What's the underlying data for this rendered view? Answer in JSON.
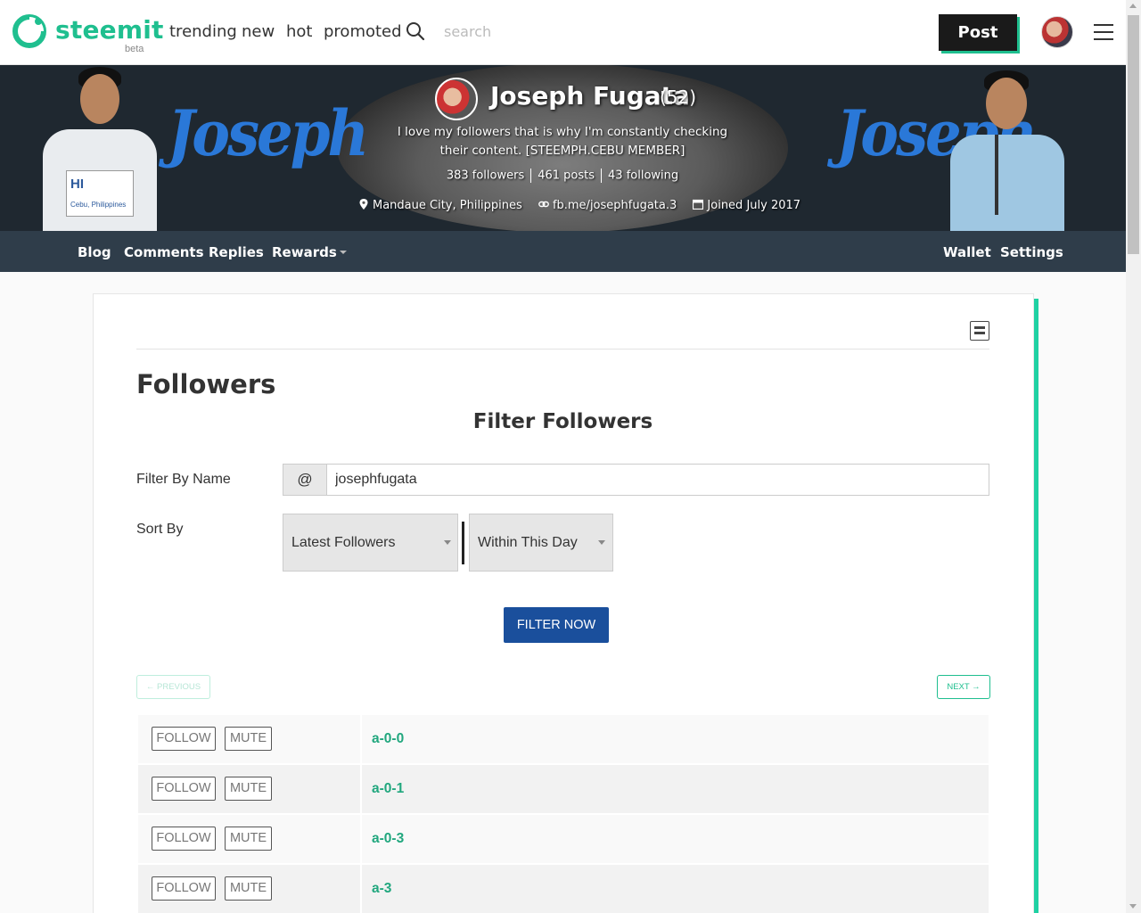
{
  "header": {
    "logo": "steemit",
    "beta": "beta",
    "nav": [
      "trending",
      "new",
      "hot",
      "promoted"
    ],
    "search_placeholder": "search",
    "post_label": "Post",
    "accent": "#1fbf8f"
  },
  "profile": {
    "name": "Joseph Fugata",
    "reputation": "(52)",
    "about": "I love my followers that is why I'm constantly checking their content. [STEEMPH.CEBU MEMBER]",
    "followers": "383 followers",
    "posts": "461 posts",
    "following": "43 following",
    "location": "Mandaue City, Philippines",
    "website": "fb.me/josephfugata.3",
    "joined": "Joined July 2017",
    "cover_text_left": "Joseph",
    "cover_text_right": "Joseph",
    "card_hi": "HI",
    "card_city": "Cebu, Philippines"
  },
  "profile_nav": {
    "blog": "Blog",
    "comments": "Comments",
    "replies": "Replies",
    "rewards": "Rewards",
    "wallet": "Wallet",
    "settings": "Settings"
  },
  "main": {
    "title": "Followers",
    "filter_title": "Filter Followers",
    "filter_by_name_label": "Filter By Name",
    "at_prefix": "@",
    "name_value": "josephfugata",
    "sort_by_label": "Sort By",
    "sort_option": "Latest Followers",
    "range_option": "Within This Day",
    "filter_button": "FILTER NOW",
    "prev_button": "← PREVIOUS",
    "next_button": "NEXT →"
  },
  "followers": [
    {
      "name": "a-0-0",
      "follow": "FOLLOW",
      "mute": "MUTE"
    },
    {
      "name": "a-0-1",
      "follow": "FOLLOW",
      "mute": "MUTE"
    },
    {
      "name": "a-0-3",
      "follow": "FOLLOW",
      "mute": "MUTE"
    },
    {
      "name": "a-3",
      "follow": "FOLLOW",
      "mute": "MUTE"
    }
  ]
}
